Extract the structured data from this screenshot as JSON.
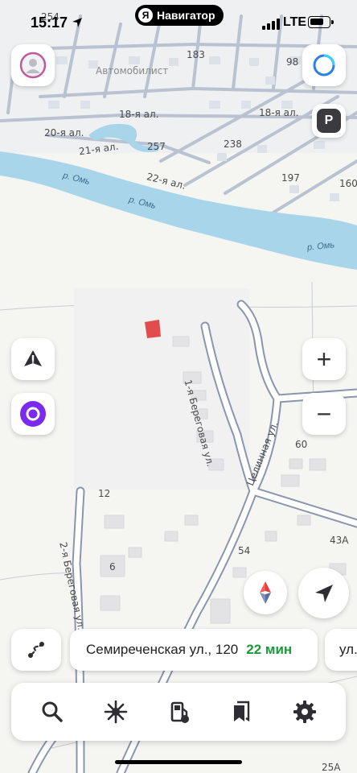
{
  "status_bar": {
    "time": "15:17",
    "app_name": "Навигатор",
    "app_badge": "Я",
    "network": "LTE"
  },
  "map": {
    "district_labels": [
      "Автомобилист"
    ],
    "street_labels": [
      "18-я ал.",
      "18-я ал.",
      "20-я ал.",
      "21-я ал.",
      "22-я ал.",
      "1-я Береговая ул.",
      "Целинная ул.",
      "2-я Береговая ул."
    ],
    "river_labels": [
      "р. Омь",
      "р. Омь",
      "р. Омь"
    ],
    "house_numbers": [
      "254",
      "183",
      "98",
      "257",
      "238",
      "197",
      "160",
      "60",
      "12",
      "54",
      "43А",
      "6",
      "25А"
    ]
  },
  "controls": {
    "parking_label": "P",
    "zoom_in": "+",
    "zoom_out": "−"
  },
  "route": {
    "destination": "Семиреченская ул., 120",
    "eta": "22 мин",
    "next_destination_partial": "ул."
  },
  "icons": {
    "avatar": "profile-avatar-icon",
    "assistant": "alice-icon",
    "warning": "road-alert-icon",
    "compass": "compass-icon",
    "my_location": "navigation-arrow-icon",
    "bottom_bar": [
      "search-icon",
      "overview-icon",
      "gas-station-icon",
      "bookmarks-icon",
      "settings-icon"
    ]
  },
  "colors": {
    "water": "#a9d5ea",
    "road": "#8a96ad",
    "eta_green": "#1a9a3a",
    "alice_purple": "#7b2bf0",
    "marker_red": "#e03a3a"
  }
}
